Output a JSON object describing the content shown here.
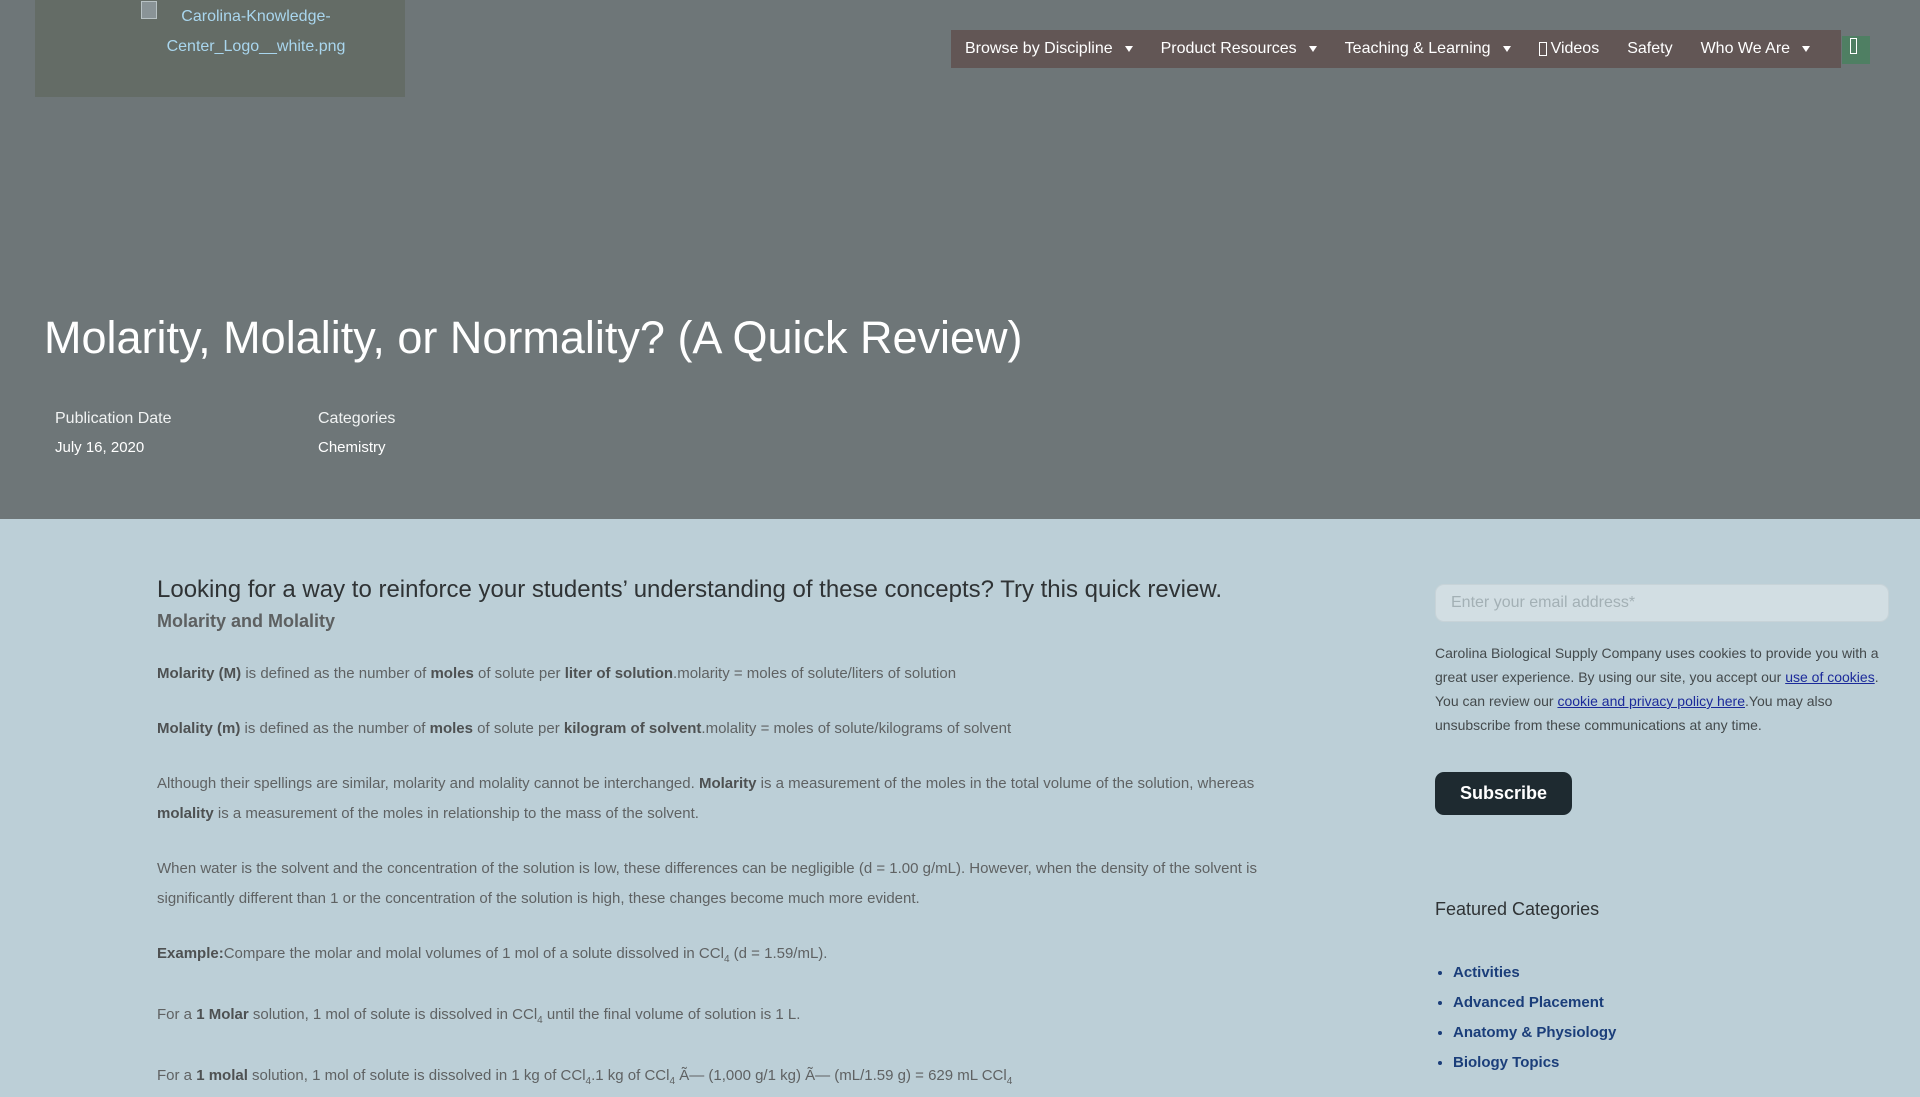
{
  "header": {
    "logo_alt": "Carolina-Knowledge-Center_Logo__white.png",
    "nav": [
      {
        "label": "Browse by Discipline",
        "has_dropdown": true
      },
      {
        "label": "Product Resources",
        "has_dropdown": true
      },
      {
        "label": "Teaching & Learning",
        "has_dropdown": true
      },
      {
        "label": "Videos",
        "has_dropdown": false
      },
      {
        "label": "Safety",
        "has_dropdown": false
      },
      {
        "label": "Who We Are",
        "has_dropdown": true
      }
    ]
  },
  "article": {
    "title": "Molarity, Molality, or Normality? (A Quick Review)",
    "publication_date_label": "Publication Date",
    "publication_date": "July 16, 2020",
    "categories_label": "Categories",
    "category": "Chemistry",
    "intro": "Looking for a way to reinforce your students’ understanding of these concepts? Try this quick review.",
    "subheading": "Molarity and Molality",
    "p1_b1": "Molarity (M)",
    "p1_t1": " is defined as the number of ",
    "p1_b2": "moles",
    "p1_t2": " of solute per ",
    "p1_b3": "liter of solution",
    "p1_t3": ".molarity = moles of solute/liters of solution",
    "p2_b1": "Molality (m)",
    "p2_t1": " is defined as the number of ",
    "p2_b2": "moles",
    "p2_t2": " of solute per ",
    "p2_b3": "kilogram of solvent",
    "p2_t3": ".molality = moles of solute/kilograms of solvent",
    "p3_t1": "Although their spellings are similar, molarity and molality cannot be interchanged. ",
    "p3_b1": "Molarity",
    "p3_t2": " is a measurement of the moles in the total volume of the solution, whereas ",
    "p3_b2": "molality",
    "p3_t3": " is a measurement of the moles in relationship to the mass of the solvent.",
    "p4": "When water is the solvent and the concentration of the solution is low, these differences can be negligible (d = 1.00 g/mL). However, when the density of the solvent is significantly different than 1 or the concentration of the solution is high, these changes become much more evident.",
    "p5_b1": "Example:",
    "p5_t1": "Compare the molar and molal volumes of 1 mol of a solute dissolved in CCl",
    "p5_t2": " (d = 1.59/mL).",
    "p6_t1": "For a ",
    "p6_b1": "1 Molar",
    "p6_t2": " solution, 1 mol of solute is dissolved in CCl",
    "p6_t3": " until the final volume of solution is 1 L.",
    "p7_t1": "For a ",
    "p7_b1": "1 molal",
    "p7_t2": " solution, 1 mol of solute is dissolved in 1 kg of CCl",
    "p7_t3": ".1 kg of CCl",
    "p7_t4": " Ã— (1,000 g/1 kg) Ã— (mL/1.59 g) = 629 mL CCl",
    "subscript": "4"
  },
  "sidebar": {
    "email_placeholder": "Enter your email address*",
    "notice_t1": "Carolina Biological Supply Company uses cookies to provide you with a great user experience. By using our site, you accept our ",
    "notice_link1": "use of cookies",
    "notice_t2": ". You can review our ",
    "notice_link2": "cookie and privacy policy here",
    "notice_t3": ".You may also unsubscribe from these communications at any time.",
    "subscribe_label": "Subscribe",
    "featured_title": "Featured Categories",
    "categories": [
      "Activities",
      "Advanced Placement",
      "Anatomy & Physiology",
      "Biology Topics"
    ]
  }
}
